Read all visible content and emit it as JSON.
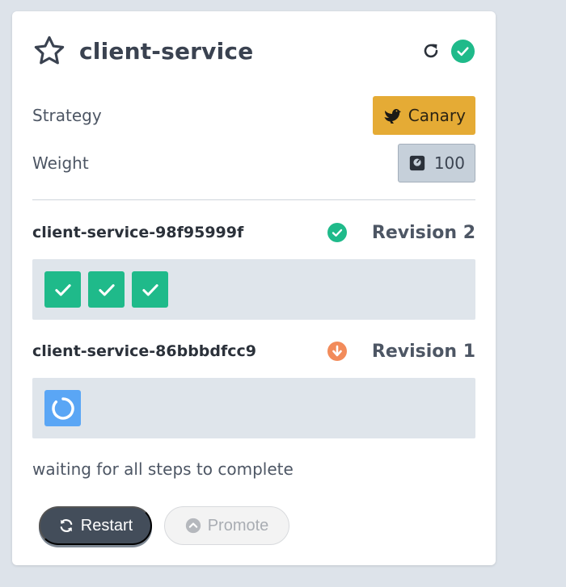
{
  "rollout": {
    "name": "client-service",
    "status": "healthy"
  },
  "strategy": {
    "label": "Strategy",
    "value": "Canary",
    "icon": "canary-bird-icon",
    "color": "#e5ab35"
  },
  "weight": {
    "label": "Weight",
    "value": "100",
    "icon": "scale-icon"
  },
  "revisions": [
    {
      "name": "client-service-98f95999f",
      "label": "Revision 2",
      "status": "healthy",
      "status_color": "#1fba8a",
      "steps": [
        "complete",
        "complete",
        "complete"
      ]
    },
    {
      "name": "client-service-86bbbdfcc9",
      "label": "Revision 1",
      "status": "scaled-down",
      "status_color": "#f28b5a",
      "steps": [
        "running"
      ]
    }
  ],
  "status_message": "waiting for all steps to complete",
  "actions": {
    "restart_label": "Restart",
    "promote_label": "Promote",
    "promote_disabled": true
  },
  "colors": {
    "success": "#1fba8a",
    "running": "#5aa6f5",
    "warning": "#f28b5a",
    "restart_bg": "#434d5a",
    "background": "#dde3ea"
  }
}
